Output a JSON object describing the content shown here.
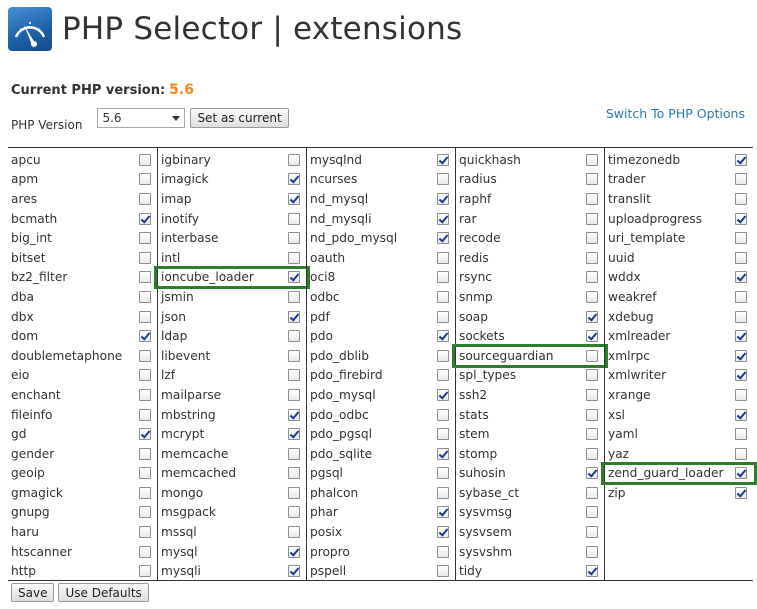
{
  "header": {
    "title": "PHP Selector | extensions"
  },
  "current": {
    "label": "Current PHP version:",
    "value": "5.6"
  },
  "selector": {
    "label": "PHP Version",
    "value": "5.6",
    "set_label": "Set as current"
  },
  "switch_link": "Switch To PHP Options",
  "columns": [
    [
      {
        "name": "apcu",
        "checked": false
      },
      {
        "name": "apm",
        "checked": false
      },
      {
        "name": "ares",
        "checked": false
      },
      {
        "name": "bcmath",
        "checked": true
      },
      {
        "name": "big_int",
        "checked": false
      },
      {
        "name": "bitset",
        "checked": false
      },
      {
        "name": "bz2_filter",
        "checked": false
      },
      {
        "name": "dba",
        "checked": false
      },
      {
        "name": "dbx",
        "checked": false
      },
      {
        "name": "dom",
        "checked": true
      },
      {
        "name": "doublemetaphone",
        "checked": false
      },
      {
        "name": "eio",
        "checked": false
      },
      {
        "name": "enchant",
        "checked": false
      },
      {
        "name": "fileinfo",
        "checked": false
      },
      {
        "name": "gd",
        "checked": true
      },
      {
        "name": "gender",
        "checked": false
      },
      {
        "name": "geoip",
        "checked": false
      },
      {
        "name": "gmagick",
        "checked": false
      },
      {
        "name": "gnupg",
        "checked": false
      },
      {
        "name": "haru",
        "checked": false
      },
      {
        "name": "htscanner",
        "checked": false
      },
      {
        "name": "http",
        "checked": false
      }
    ],
    [
      {
        "name": "igbinary",
        "checked": false
      },
      {
        "name": "imagick",
        "checked": true
      },
      {
        "name": "imap",
        "checked": true
      },
      {
        "name": "inotify",
        "checked": false
      },
      {
        "name": "interbase",
        "checked": false
      },
      {
        "name": "intl",
        "checked": false
      },
      {
        "name": "ioncube_loader",
        "checked": true,
        "highlight": true
      },
      {
        "name": "jsmin",
        "checked": false
      },
      {
        "name": "json",
        "checked": true
      },
      {
        "name": "ldap",
        "checked": false
      },
      {
        "name": "libevent",
        "checked": false
      },
      {
        "name": "lzf",
        "checked": false
      },
      {
        "name": "mailparse",
        "checked": false
      },
      {
        "name": "mbstring",
        "checked": true
      },
      {
        "name": "mcrypt",
        "checked": true
      },
      {
        "name": "memcache",
        "checked": false
      },
      {
        "name": "memcached",
        "checked": false
      },
      {
        "name": "mongo",
        "checked": false
      },
      {
        "name": "msgpack",
        "checked": false
      },
      {
        "name": "mssql",
        "checked": false
      },
      {
        "name": "mysql",
        "checked": true
      },
      {
        "name": "mysqli",
        "checked": true
      }
    ],
    [
      {
        "name": "mysqlnd",
        "checked": true
      },
      {
        "name": "ncurses",
        "checked": false
      },
      {
        "name": "nd_mysql",
        "checked": true
      },
      {
        "name": "nd_mysqli",
        "checked": true
      },
      {
        "name": "nd_pdo_mysql",
        "checked": true
      },
      {
        "name": "oauth",
        "checked": false
      },
      {
        "name": "oci8",
        "checked": false
      },
      {
        "name": "odbc",
        "checked": false
      },
      {
        "name": "pdf",
        "checked": false
      },
      {
        "name": "pdo",
        "checked": true
      },
      {
        "name": "pdo_dblib",
        "checked": false
      },
      {
        "name": "pdo_firebird",
        "checked": false
      },
      {
        "name": "pdo_mysql",
        "checked": true
      },
      {
        "name": "pdo_odbc",
        "checked": false
      },
      {
        "name": "pdo_pgsql",
        "checked": false
      },
      {
        "name": "pdo_sqlite",
        "checked": true
      },
      {
        "name": "pgsql",
        "checked": false
      },
      {
        "name": "phalcon",
        "checked": false
      },
      {
        "name": "phar",
        "checked": true
      },
      {
        "name": "posix",
        "checked": true
      },
      {
        "name": "propro",
        "checked": false
      },
      {
        "name": "pspell",
        "checked": false
      }
    ],
    [
      {
        "name": "quickhash",
        "checked": false
      },
      {
        "name": "radius",
        "checked": false
      },
      {
        "name": "raphf",
        "checked": false
      },
      {
        "name": "rar",
        "checked": false
      },
      {
        "name": "recode",
        "checked": false
      },
      {
        "name": "redis",
        "checked": false
      },
      {
        "name": "rsync",
        "checked": false
      },
      {
        "name": "snmp",
        "checked": false
      },
      {
        "name": "soap",
        "checked": true
      },
      {
        "name": "sockets",
        "checked": true
      },
      {
        "name": "sourceguardian",
        "checked": false,
        "highlight": true
      },
      {
        "name": "spl_types",
        "checked": false
      },
      {
        "name": "ssh2",
        "checked": false
      },
      {
        "name": "stats",
        "checked": false
      },
      {
        "name": "stem",
        "checked": false
      },
      {
        "name": "stomp",
        "checked": false
      },
      {
        "name": "suhosin",
        "checked": true
      },
      {
        "name": "sybase_ct",
        "checked": false
      },
      {
        "name": "sysvmsg",
        "checked": false
      },
      {
        "name": "sysvsem",
        "checked": false
      },
      {
        "name": "sysvshm",
        "checked": false
      },
      {
        "name": "tidy",
        "checked": true
      }
    ],
    [
      {
        "name": "timezonedb",
        "checked": true
      },
      {
        "name": "trader",
        "checked": false
      },
      {
        "name": "translit",
        "checked": false
      },
      {
        "name": "uploadprogress",
        "checked": true
      },
      {
        "name": "uri_template",
        "checked": false
      },
      {
        "name": "uuid",
        "checked": false
      },
      {
        "name": "wddx",
        "checked": true
      },
      {
        "name": "weakref",
        "checked": false
      },
      {
        "name": "xdebug",
        "checked": false
      },
      {
        "name": "xmlreader",
        "checked": true
      },
      {
        "name": "xmlrpc",
        "checked": true
      },
      {
        "name": "xmlwriter",
        "checked": true
      },
      {
        "name": "xrange",
        "checked": false
      },
      {
        "name": "xsl",
        "checked": true
      },
      {
        "name": "yaml",
        "checked": false
      },
      {
        "name": "yaz",
        "checked": false
      },
      {
        "name": "zend_guard_loader",
        "checked": true,
        "highlight": true
      },
      {
        "name": "zip",
        "checked": true
      }
    ]
  ],
  "footer": {
    "save_label": "Save",
    "defaults_label": "Use Defaults"
  },
  "colors": {
    "accent": "#f0861e",
    "link": "#2a7ab8",
    "highlight": "#2d7d2d"
  },
  "icons": {
    "logo": "tachometer-gauge-icon",
    "dropdown": "chevron-down-icon"
  }
}
